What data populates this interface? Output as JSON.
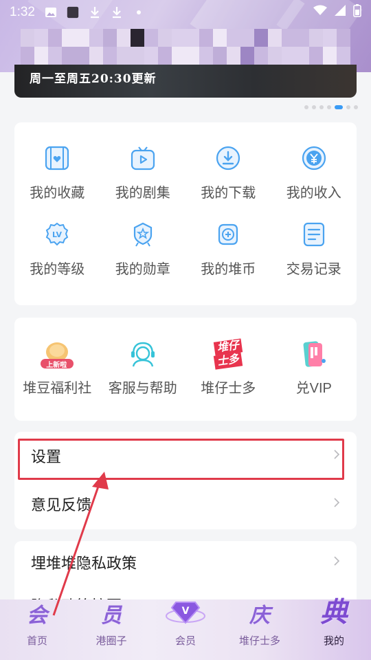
{
  "status_bar": {
    "time": "1:32"
  },
  "banner": {
    "text": "周一至周五20:30更新"
  },
  "carousel": {
    "active_index": 4,
    "count": 6
  },
  "my_section": {
    "items": [
      {
        "label": "我的收藏",
        "icon": "collection-video-icon"
      },
      {
        "label": "我的剧集",
        "icon": "tv-icon"
      },
      {
        "label": "我的下载",
        "icon": "download-icon"
      },
      {
        "label": "我的收入",
        "icon": "yen-coin-icon"
      },
      {
        "label": "我的等级",
        "icon": "level-badge-icon"
      },
      {
        "label": "我的勋章",
        "icon": "medal-icon"
      },
      {
        "label": "我的堆币",
        "icon": "coin-icon"
      },
      {
        "label": "交易记录",
        "icon": "document-list-icon"
      }
    ]
  },
  "services": {
    "items": [
      {
        "label": "堆豆福利社",
        "icon": "bean-icon",
        "badge": "上新啦"
      },
      {
        "label": "客服与帮助",
        "icon": "customer-service-icon"
      },
      {
        "label": "堆仔士多",
        "icon": "store-logo-icon",
        "logo_text_1": "堆仔",
        "logo_text_2": "士多"
      },
      {
        "label": "兑VIP",
        "icon": "vip-card-icon"
      }
    ]
  },
  "settings_list": {
    "settings": "设置",
    "feedback": "意见反馈"
  },
  "privacy_list": {
    "privacy_policy": "埋堆堆隐私政策",
    "privacy_summary": "隐私政策摘要"
  },
  "tabbar": {
    "tabs": [
      {
        "label": "首页",
        "glyph": "会"
      },
      {
        "label": "港圈子",
        "glyph": "员"
      },
      {
        "label": "会员",
        "glyph": "V"
      },
      {
        "label": "堆仔士多",
        "glyph": "庆"
      },
      {
        "label": "我的",
        "glyph": "典"
      }
    ],
    "active": 4
  },
  "colors": {
    "accent_blue": "#3a9bf5",
    "highlight_red": "#e03a4a",
    "tab_purple": "#8b62d6"
  }
}
